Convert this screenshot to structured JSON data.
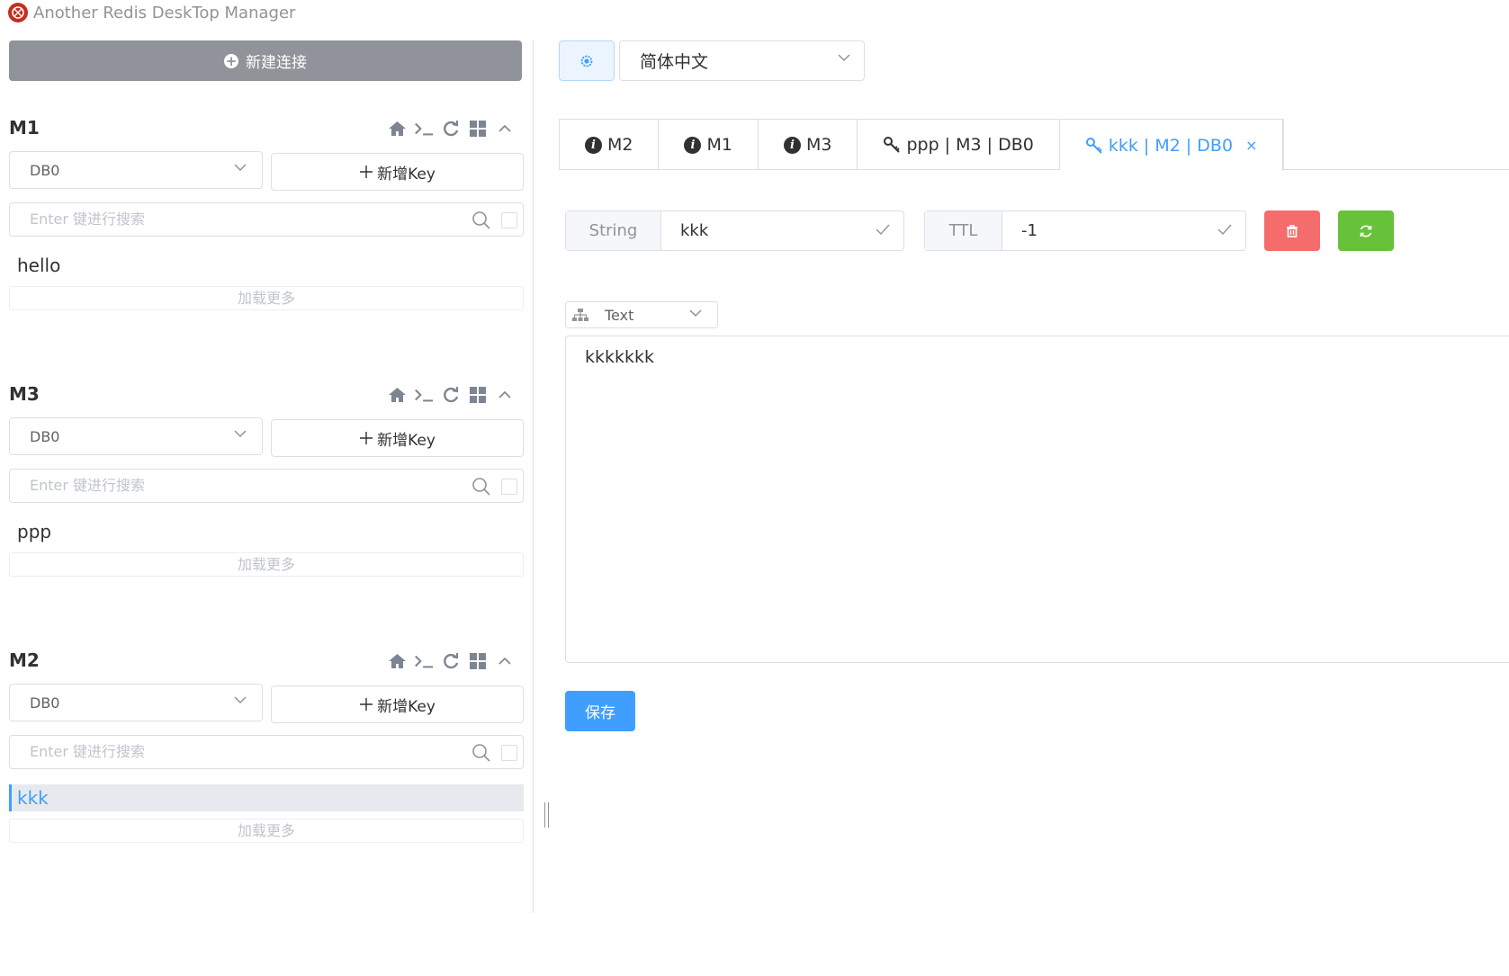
{
  "app": {
    "title": "Another Redis DeskTop Manager",
    "logo_icon": "redis-logo-icon"
  },
  "sidebar": {
    "new_connection_label": "新建连接",
    "connections": [
      {
        "name": "M1",
        "db": "DB0",
        "add_key_label": "新增Key",
        "search_placeholder": "Enter 键进行搜索",
        "keys": [
          "hello"
        ],
        "load_more": "加载更多"
      },
      {
        "name": "M3",
        "db": "DB0",
        "add_key_label": "新增Key",
        "search_placeholder": "Enter 键进行搜索",
        "keys": [
          "ppp"
        ],
        "load_more": "加载更多"
      },
      {
        "name": "M2",
        "db": "DB0",
        "add_key_label": "新增Key",
        "search_placeholder": "Enter 键进行搜索",
        "keys": [
          "kkk"
        ],
        "load_more": "加载更多"
      }
    ],
    "tool_icons": [
      "home-icon",
      "terminal-icon",
      "refresh-icon",
      "grid-icon",
      "collapse-icon"
    ]
  },
  "topbar": {
    "settings_icon": "gear-icon",
    "language": "简体中文"
  },
  "tabs": [
    {
      "label": "M2",
      "icon": "info-icon"
    },
    {
      "label": "M1",
      "icon": "info-icon"
    },
    {
      "label": "M3",
      "icon": "info-icon"
    },
    {
      "label": "ppp | M3 | DB0",
      "icon": "key-icon"
    },
    {
      "label": "kkk | M2 | DB0",
      "icon": "key-icon",
      "active": true
    }
  ],
  "key_detail": {
    "type": "String",
    "key_name": "kkk",
    "ttl_label": "TTL",
    "ttl_value": "-1",
    "format": "Text",
    "value": "kkkkkkk",
    "save_label": "保存"
  },
  "colors": {
    "primary": "#409eff",
    "danger": "#f56c6c",
    "success": "#67c23a",
    "sidebar_button": "#909399"
  }
}
